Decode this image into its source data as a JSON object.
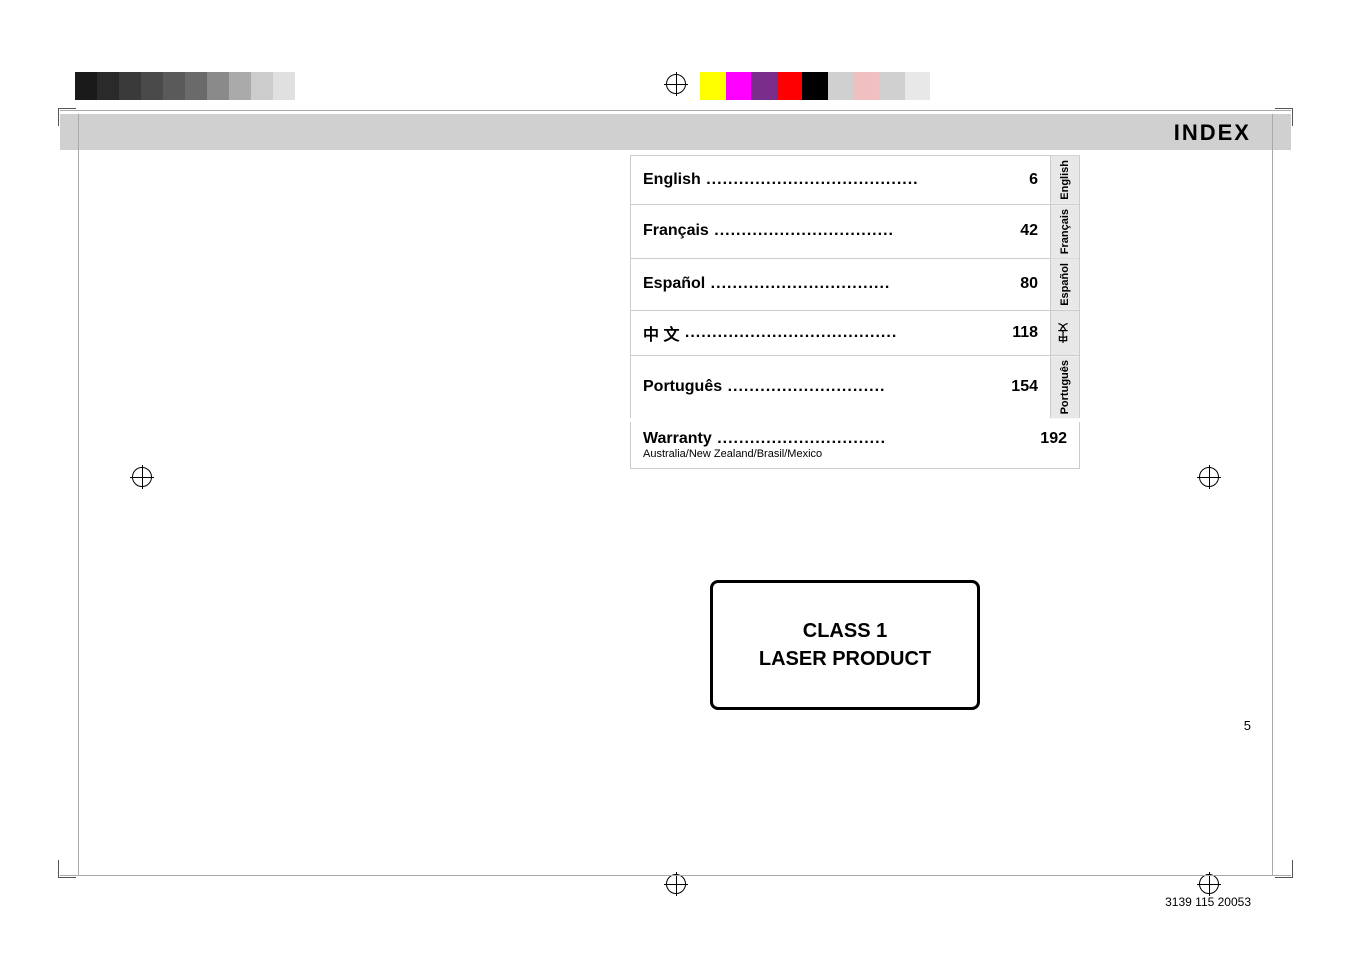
{
  "page": {
    "background": "#ffffff",
    "doc_number": "3139 115 20053",
    "page_number": "5"
  },
  "header": {
    "title": "INDEX"
  },
  "index": {
    "items": [
      {
        "label": "English",
        "dots": ".....................................",
        "page": "6",
        "tab": "English"
      },
      {
        "label": "Français",
        "dots": ".................................",
        "page": "42",
        "tab": "Français"
      },
      {
        "label": "Español",
        "dots": ".................................",
        "page": "80",
        "tab": "Español"
      },
      {
        "label": "中 文",
        "dots": ".....................................",
        "page": "118",
        "tab": "中文"
      },
      {
        "label": "Português",
        "dots": "...........................",
        "page": "154",
        "tab": "Português"
      }
    ],
    "warranty": {
      "label": "Warranty",
      "dots": "...............................",
      "page": "192",
      "subtitle": "Australia/New Zealand/Brasil/Mexico"
    }
  },
  "laser_product": {
    "line1": "CLASS 1",
    "line2": "LASER PRODUCT"
  },
  "color_bar_left": {
    "colors": [
      "#1a1a1a",
      "#2d2d2d",
      "#3d3d3d",
      "#4d4d4d",
      "#5d5d5d",
      "#777777",
      "#939393",
      "#b0b0b0",
      "#cccccc",
      "#e0e0e0"
    ]
  },
  "color_bar_right": {
    "colors": [
      "#f5e800",
      "#e800e8",
      "#7b2d8b",
      "#e80000",
      "#111111",
      "#c8c8c8",
      "#f0c0c0",
      "#d8d8d8",
      "#ececec"
    ]
  }
}
